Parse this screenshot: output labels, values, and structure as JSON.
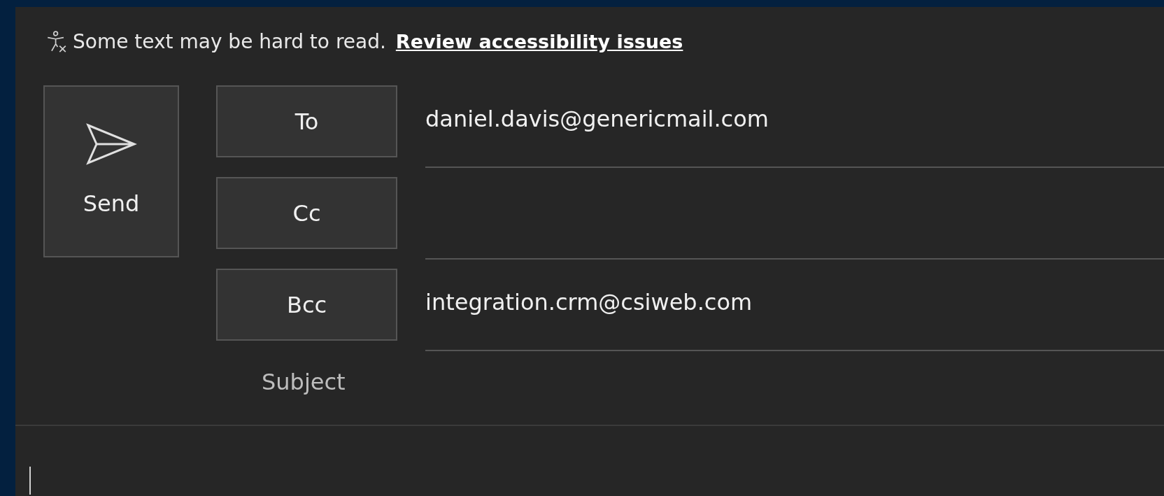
{
  "banner": {
    "text": "Some text may be hard to read.",
    "link": "Review accessibility issues"
  },
  "send_button": {
    "label": "Send"
  },
  "recipients": [
    {
      "label": "To",
      "value": "daniel.davis@genericmail.com"
    },
    {
      "label": "Cc"
    },
    {
      "label": "Bcc",
      "value": "integration.crm@csiweb.com"
    }
  ],
  "subject": {
    "placeholder": "Subject"
  }
}
